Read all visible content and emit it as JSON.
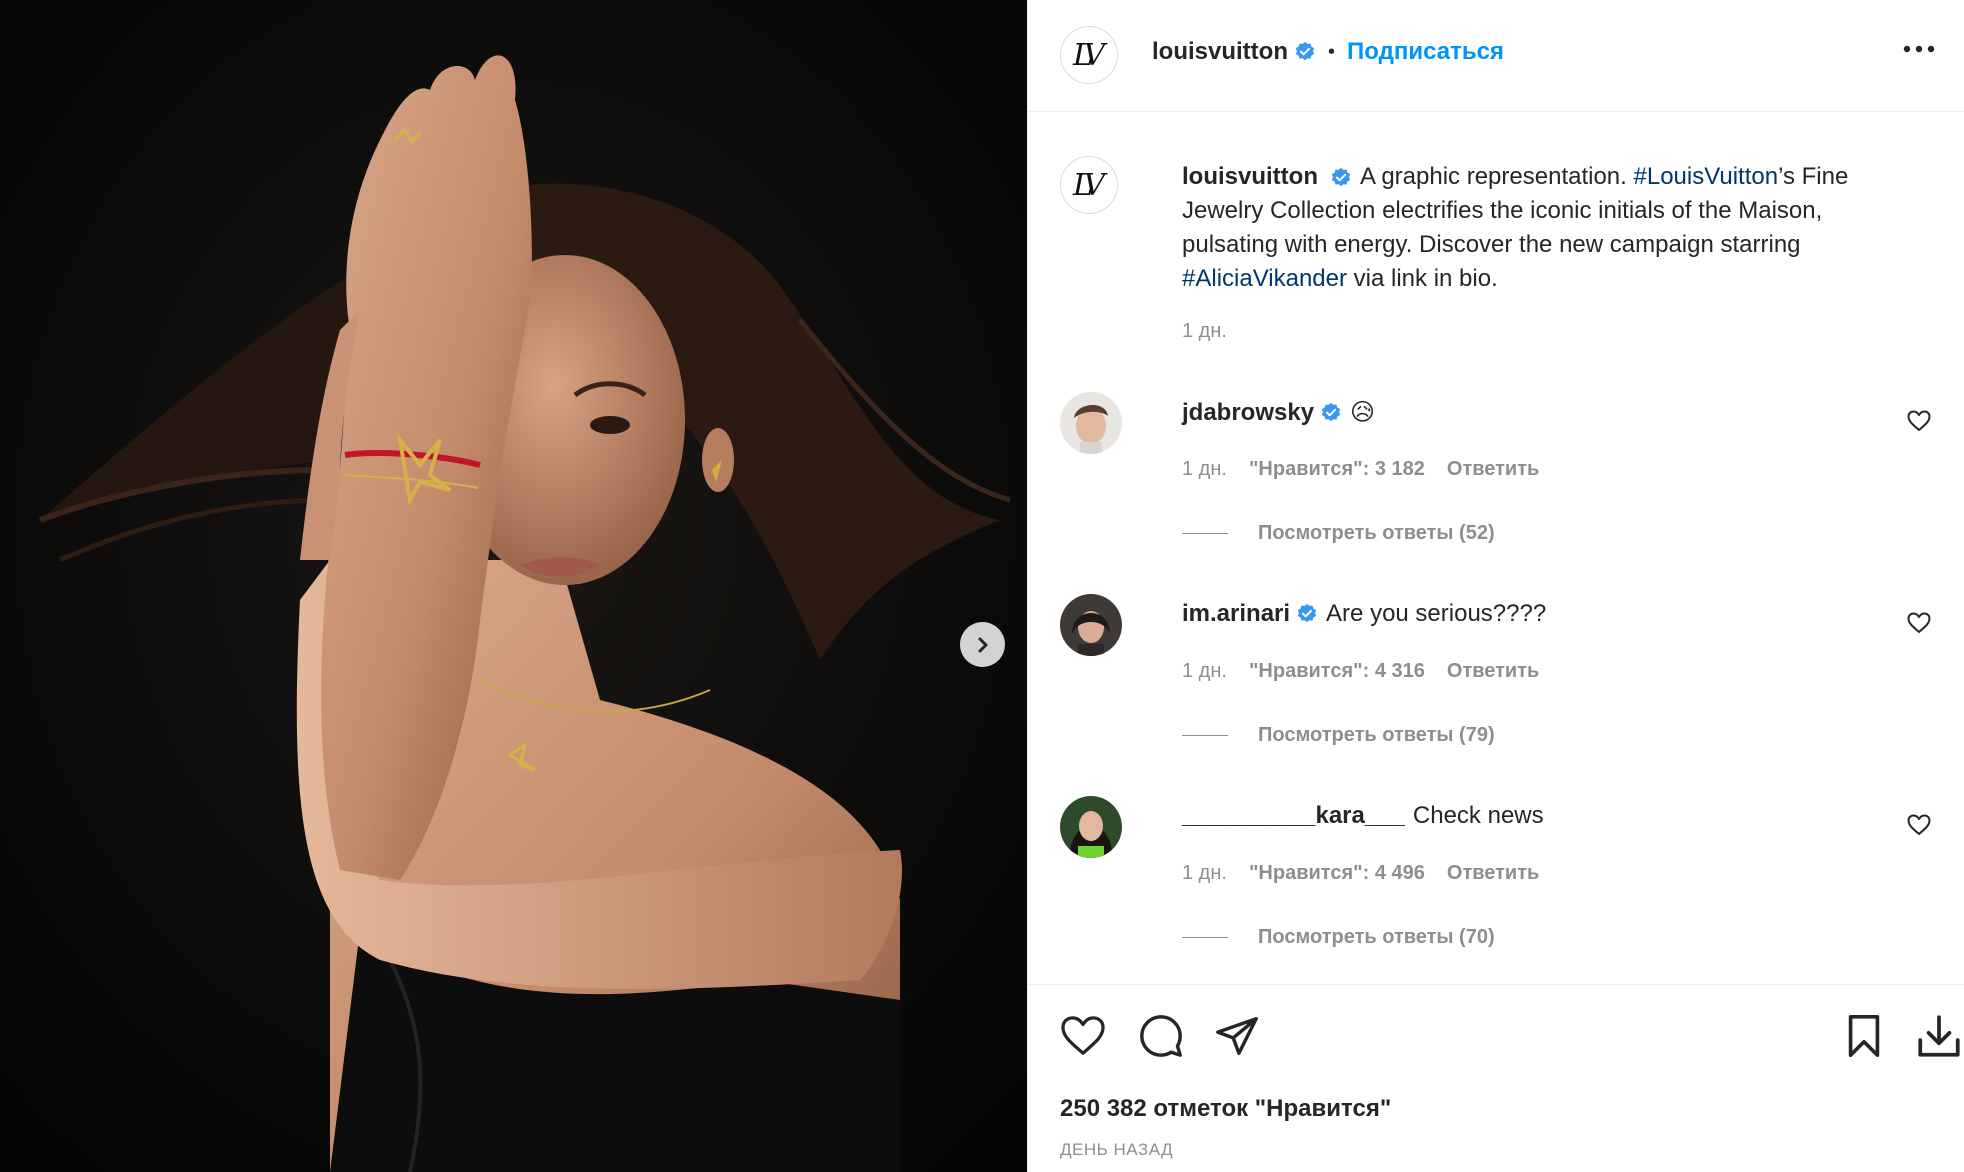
{
  "post": {
    "author": "louisvuitton",
    "follow_label": "Подписаться",
    "separator": "•",
    "caption": {
      "username": "louisvuitton",
      "text_1": "A graphic representation. ",
      "hashtag_1": "#LouisVuitton",
      "text_2": "’s Fine Jewelry Collection electrifies the iconic initials of the Maison, pulsating with energy. Discover the new campaign starring ",
      "hashtag_2": "#AliciaVikander",
      "text_3": " via link in bio.",
      "time": "1 дн."
    },
    "likes_text": "250 382 отметок \"Нравится\"",
    "date_text": "ДЕНЬ НАЗАД",
    "brand_color": "#0095f6"
  },
  "comments": [
    {
      "username": "jdabrowsky",
      "verified": true,
      "text": "😥",
      "time": "1 дн.",
      "likes": "\"Нравится\": 3 182",
      "reply": "Ответить",
      "view_replies": "Посмотреть ответы (52)"
    },
    {
      "username": "im.arinari",
      "verified": true,
      "text": "Are you serious????",
      "time": "1 дн.",
      "likes": "\"Нравится\": 4 316",
      "reply": "Ответить",
      "view_replies": "Посмотреть ответы (79)"
    },
    {
      "username": "__________kara___",
      "verified": false,
      "text": "Check news",
      "time": "1 дн.",
      "likes": "\"Нравится\": 4 496",
      "reply": "Ответить",
      "view_replies": "Посмотреть ответы (70)"
    }
  ],
  "icons": {
    "verified": "verified-badge-icon",
    "more": "more-options-icon",
    "next": "chevron-right-icon",
    "like": "heart-icon",
    "comment": "comment-icon",
    "share": "paper-plane-icon",
    "save": "bookmark-icon",
    "download": "download-icon"
  }
}
